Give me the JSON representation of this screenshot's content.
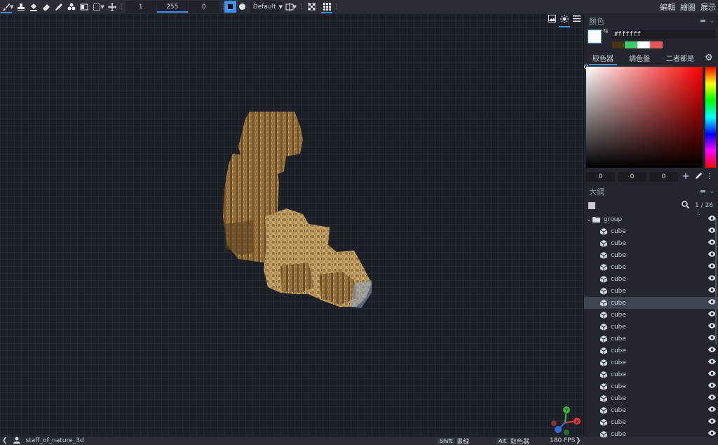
{
  "toolbar": {
    "tools": [
      "brush-icon",
      "stamp-icon",
      "fill-bucket-icon",
      "eraser-icon",
      "color-picker-icon",
      "shapes-icon",
      "gradient-icon",
      "selection-icon",
      "move-icon"
    ],
    "size_value": "1",
    "opacity_value": "255",
    "softness_value": "0",
    "brush_shape_select": "Default"
  },
  "mode_tabs": [
    "編輯",
    "繪圖",
    "展示"
  ],
  "active_mode": "繪圖",
  "color_panel": {
    "title": "顏色",
    "hex_value": "#ffffff",
    "palette": [
      "#4b3216",
      "#3fc96e",
      "#ffffff",
      "#e05757"
    ],
    "tabs": [
      "取色器",
      "調色盤",
      "二者都是"
    ],
    "active_tab": "取色器",
    "rgb": [
      "0",
      "0",
      "0"
    ]
  },
  "outliner": {
    "title": "大綱",
    "count": "1 / 26",
    "group_label": "group",
    "items": [
      "cube",
      "cube",
      "cube",
      "cube",
      "cube",
      "cube",
      "cube",
      "cube",
      "cube",
      "cube",
      "cube",
      "cube",
      "cube",
      "cube",
      "cube",
      "cube",
      "cube",
      "cube"
    ],
    "selected_index": 6
  },
  "statusbar": {
    "project_name": "staff_of_nature_3d",
    "shift_key": "Shift",
    "shift_action": "畫線",
    "alt_key": "Alt",
    "alt_action": "取色器",
    "fps": "180 FPS"
  },
  "gizmo": {
    "x_label": "X",
    "y_label": "Y",
    "colors": {
      "x": "#e0353c",
      "y": "#36b341",
      "z": "#3768d8"
    }
  }
}
